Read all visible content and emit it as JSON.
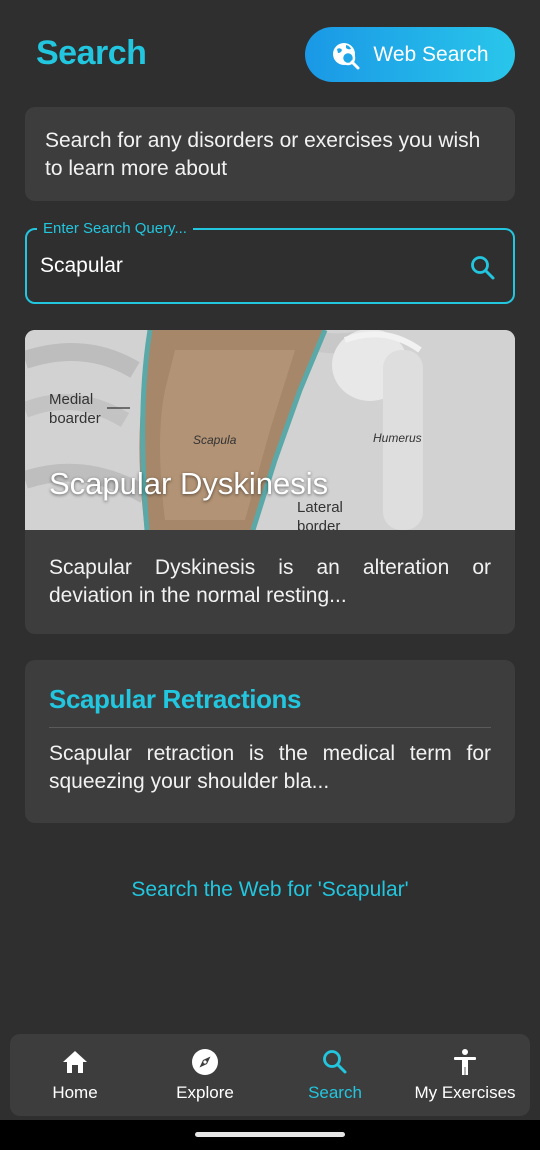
{
  "header": {
    "title": "Search",
    "web_search_label": "Web Search"
  },
  "info_card": {
    "text": "Search for any disorders or exercises you wish to learn more about"
  },
  "search": {
    "label": "Enter Search Query...",
    "value": "Scapular"
  },
  "results": [
    {
      "title": "Scapular Dyskinesis",
      "description": "Scapular Dyskinesis is an alteration or deviation in the normal resting...",
      "image_labels": {
        "medial": "Medial\nboarder",
        "scapula": "Scapula",
        "humerus": "Humerus",
        "lateral": "Lateral\nborder"
      }
    },
    {
      "title": "Scapular Retractions",
      "description": "Scapular retraction is the medical term for squeezing your shoulder bla..."
    }
  ],
  "web_link": "Search the Web for 'Scapular'",
  "nav": [
    {
      "label": "Home",
      "icon": "home-icon"
    },
    {
      "label": "Explore",
      "icon": "compass-icon"
    },
    {
      "label": "Search",
      "icon": "search-icon",
      "active": true
    },
    {
      "label": "My Exercises",
      "icon": "accessibility-icon"
    }
  ],
  "colors": {
    "accent": "#22c6df",
    "background": "#2f2f2f",
    "card": "#3d3d3d"
  }
}
